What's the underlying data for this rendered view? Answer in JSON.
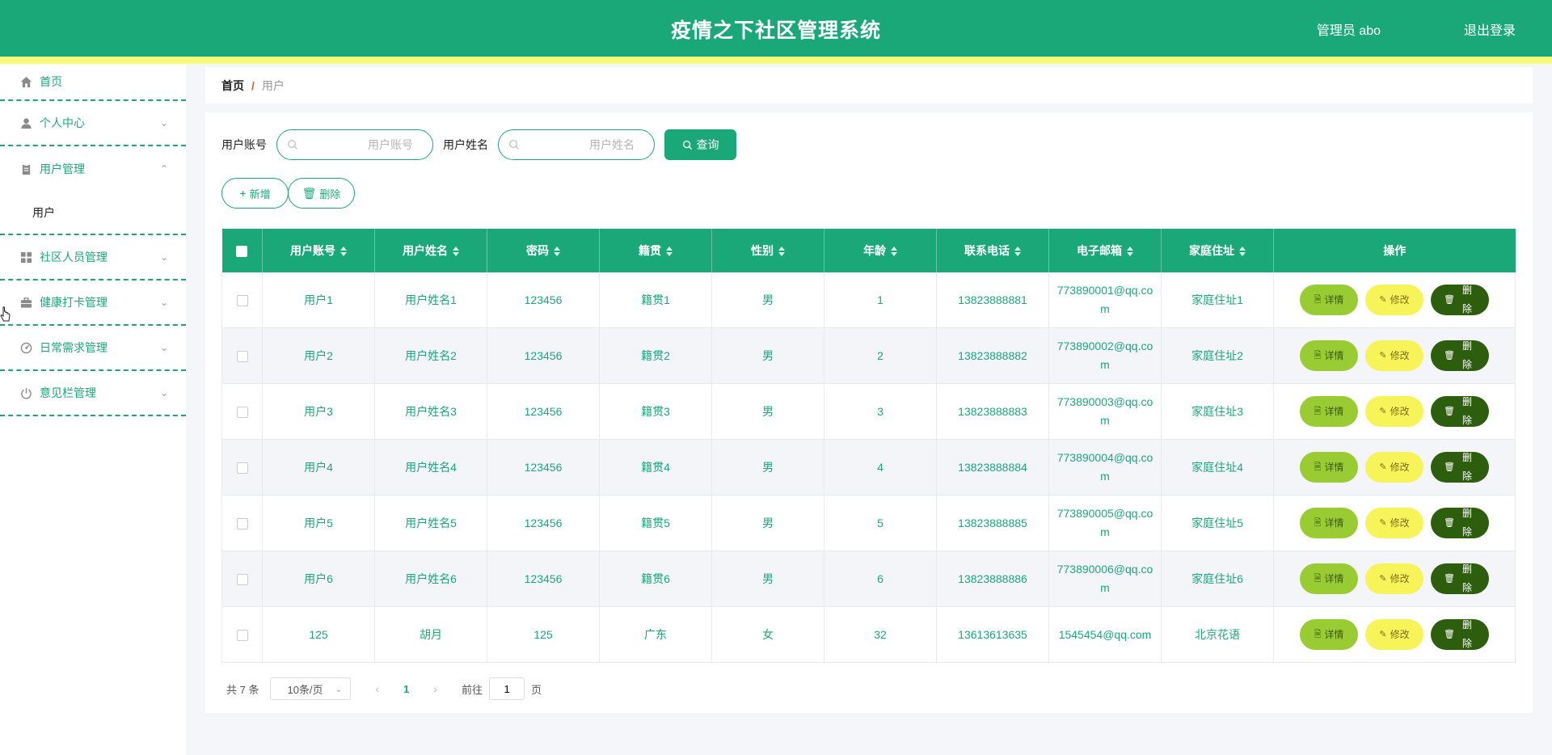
{
  "header": {
    "title": "疫情之下社区管理系统",
    "user": "管理员 abo",
    "logout": "退出登录"
  },
  "sidebar": {
    "items": [
      {
        "label": "首页",
        "icon": "home-icon"
      },
      {
        "label": "个人中心",
        "icon": "user-icon",
        "arrow": "⌄"
      },
      {
        "label": "用户管理",
        "icon": "clipboard-icon",
        "arrow": "⌃"
      },
      {
        "label": "社区人员管理",
        "icon": "grid-icon",
        "arrow": "⌄"
      },
      {
        "label": "健康打卡管理",
        "icon": "briefcase-icon",
        "arrow": "⌄"
      },
      {
        "label": "日常需求管理",
        "icon": "dashboard-icon",
        "arrow": "⌄"
      },
      {
        "label": "意见栏管理",
        "icon": "power-icon",
        "arrow": "⌄"
      }
    ],
    "sub_item": "用户"
  },
  "breadcrumb": {
    "home": "首页",
    "sep": "/",
    "current": "用户"
  },
  "search": {
    "account_label": "用户账号",
    "account_placeholder": "用户账号",
    "name_label": "用户姓名",
    "name_placeholder": "用户姓名",
    "query_button": "查询"
  },
  "actions": {
    "add": "新增",
    "delete": "删除"
  },
  "table": {
    "headers": [
      "用户账号",
      "用户姓名",
      "密码",
      "籍贯",
      "性别",
      "年龄",
      "联系电话",
      "电子邮箱",
      "家庭住址",
      "操作"
    ],
    "rows": [
      [
        "用户1",
        "用户姓名1",
        "123456",
        "籍贯1",
        "男",
        "1",
        "13823888881",
        "773890001@qq.com",
        "家庭住址1"
      ],
      [
        "用户2",
        "用户姓名2",
        "123456",
        "籍贯2",
        "男",
        "2",
        "13823888882",
        "773890002@qq.com",
        "家庭住址2"
      ],
      [
        "用户3",
        "用户姓名3",
        "123456",
        "籍贯3",
        "男",
        "3",
        "13823888883",
        "773890003@qq.com",
        "家庭住址3"
      ],
      [
        "用户4",
        "用户姓名4",
        "123456",
        "籍贯4",
        "男",
        "4",
        "13823888884",
        "773890004@qq.com",
        "家庭住址4"
      ],
      [
        "用户5",
        "用户姓名5",
        "123456",
        "籍贯5",
        "男",
        "5",
        "13823888885",
        "773890005@qq.com",
        "家庭住址5"
      ],
      [
        "用户6",
        "用户姓名6",
        "123456",
        "籍贯6",
        "男",
        "6",
        "13823888886",
        "773890006@qq.com",
        "家庭住址6"
      ],
      [
        "125",
        "胡月",
        "125",
        "广东",
        "女",
        "32",
        "13613613635",
        "1545454@qq.com",
        "北京花语"
      ]
    ],
    "op_detail": "详情",
    "op_edit": "修改",
    "op_delete": "删除"
  },
  "pagination": {
    "total": "共 7 条",
    "page_size": "10条/页",
    "current": "1",
    "goto_prefix": "前往",
    "goto_value": "1",
    "goto_suffix": "页"
  },
  "colors": {
    "primary": "#1ba879",
    "strip": "#f7fa7a",
    "detail": "#99cc33",
    "edit": "#f7f45a",
    "delete": "#2d5e0d"
  }
}
